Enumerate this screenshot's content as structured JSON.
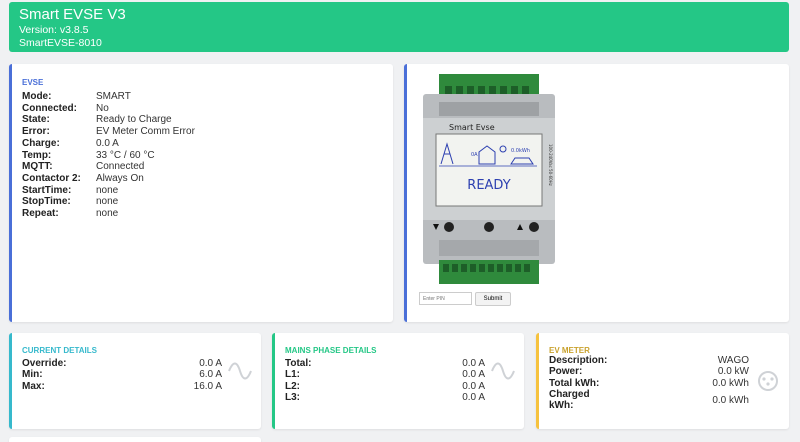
{
  "header": {
    "title": "Smart EVSE V3",
    "version": "Version: v3.8.5",
    "serial": "SmartEVSE-8010"
  },
  "evse": {
    "title": "EVSE",
    "rows": [
      {
        "label": "Mode:",
        "value": "SMART"
      },
      {
        "label": "Connected:",
        "value": "No"
      },
      {
        "label": "State:",
        "value": "Ready to Charge"
      },
      {
        "label": "Error:",
        "value": "EV Meter Comm Error"
      },
      {
        "label": "Charge:",
        "value": "0.0 A"
      },
      {
        "label": "Temp:",
        "value": "33 °C / 60 °C"
      },
      {
        "label": "MQTT:",
        "value": "Connected"
      },
      {
        "label": "Contactor 2:",
        "value": "Always On"
      },
      {
        "label": "StartTime:",
        "value": "none"
      },
      {
        "label": "StopTime:",
        "value": "none"
      },
      {
        "label": "Repeat:",
        "value": "none"
      }
    ]
  },
  "device": {
    "brand": "Smart Evse",
    "screen_status": "READY",
    "screen_energy": "0.0kWh",
    "screen_amp": "0A",
    "side_label": "100-240Vac 50-60Hz"
  },
  "pin": {
    "placeholder": "Enter PIN",
    "submit_label": "Submit"
  },
  "current": {
    "title": "Current Details",
    "rows": [
      {
        "label": "Override:",
        "value": "0.0 A"
      },
      {
        "label": "Min:",
        "value": "6.0 A"
      },
      {
        "label": "Max:",
        "value": "16.0 A"
      }
    ]
  },
  "mains": {
    "title": "Mains Phase Details",
    "rows": [
      {
        "label": "Total:",
        "value": "0.0 A"
      },
      {
        "label": "L1:",
        "value": "0.0 A"
      },
      {
        "label": "L2:",
        "value": "0.0 A"
      },
      {
        "label": "L3:",
        "value": "0.0 A"
      }
    ]
  },
  "ev_meter": {
    "title": "EV Meter",
    "rows": [
      {
        "label": "Description:",
        "value": "WAGO"
      },
      {
        "label": "Power:",
        "value": "0.0 kW"
      },
      {
        "label": "Total kWh:",
        "value": "0.0 kWh"
      },
      {
        "label": "Charged kWh:",
        "value": "0.0 kWh"
      }
    ]
  },
  "colors": {
    "header": "#24c786",
    "evse_accent": "#4a6fd8",
    "current_accent": "#36b9cc",
    "mains_accent": "#24c786",
    "ev_accent": "#f6c23e"
  },
  "icons": {
    "current": "sine-wave-icon",
    "mains": "sine-wave-icon",
    "ev": "ev-plug-icon"
  }
}
